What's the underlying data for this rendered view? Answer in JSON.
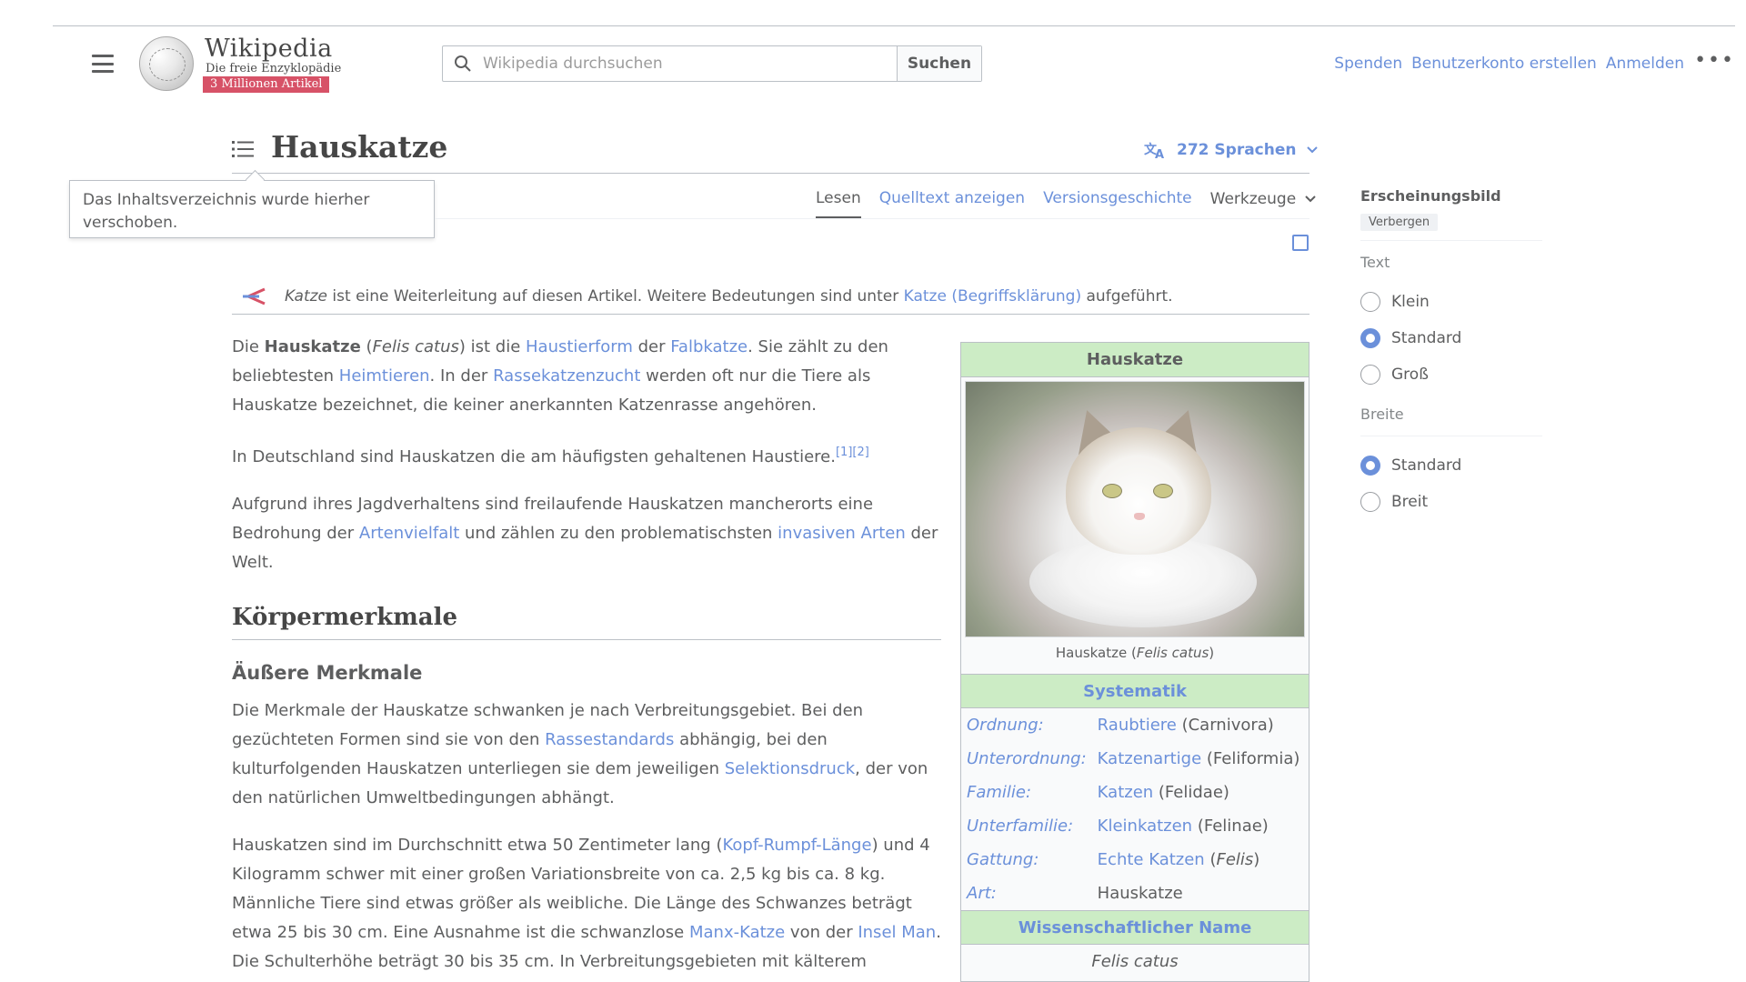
{
  "header": {
    "wordmark": "Wikipedia",
    "tagline": "Die freie Enzyklopädie",
    "badge": "3 Millionen Artikel",
    "search_placeholder": "Wikipedia durchsuchen",
    "search_button": "Suchen",
    "user_links": [
      "Spenden",
      "Benutzerkonto erstellen",
      "Anmelden"
    ],
    "more": "•••"
  },
  "article": {
    "title": "Hauskatze",
    "languages": "272 Sprachen",
    "tooltip": "Das Inhaltsverzeichnis wurde hierher verschoben.",
    "tabs": {
      "read": "Lesen",
      "source": "Quelltext anzeigen",
      "history": "Versionsgeschichte",
      "tools": "Werkzeuge"
    },
    "hatnote": {
      "term": "Katze",
      "text1": " ist eine Weiterleitung auf diesen Artikel. Weitere Bedeutungen sind unter ",
      "link": "Katze (Begriffsklärung)",
      "text2": " aufgeführt."
    },
    "p1": {
      "a": "Die ",
      "b": "Hauskatze",
      "c": " (",
      "d": "Felis catus",
      "e": ") ist die ",
      "f": "Haustierform",
      "g": " der ",
      "h": "Falbkatze",
      "i": ". Sie zählt zu den beliebtesten ",
      "j": "Heimtieren",
      "k": ". In der ",
      "l": "Rassekatzenzucht",
      "m": " werden oft nur die Tiere als Hauskatze bezeichnet, die keiner anerkannten Katzenrasse angehören."
    },
    "p2": {
      "text": "In Deutschland sind Hauskatzen die am häufigsten gehaltenen Haustiere.",
      "refs": "[1][2]"
    },
    "p3": {
      "a": "Aufgrund ihres Jagdverhaltens sind freilaufende Hauskatzen mancherorts eine Bedrohung der ",
      "b": "Artenvielfalt",
      "c": " und zählen zu den problematischsten ",
      "d": "invasiven Arten",
      "e": " der Welt."
    },
    "h2": "Körpermerkmale",
    "h3": "Äußere Merkmale",
    "p4": {
      "a": "Die Merkmale der Hauskatze schwanken je nach Verbreitungsgebiet. Bei den gezüchteten Formen sind sie von den ",
      "b": "Rassestandards",
      "c": " abhängig, bei den kulturfolgenden Hauskatzen unterliegen sie dem jeweiligen ",
      "d": "Selektionsdruck",
      "e": ", der von den natürlichen Umweltbedingungen abhängt."
    },
    "p5": {
      "a": "Hauskatzen sind im Durchschnitt etwa 50 Zentimeter lang (",
      "b": "Kopf-Rumpf-Länge",
      "c": ") und 4 Kilogramm schwer mit einer großen Variationsbreite von ca. 2,5 kg bis ca. 8 kg. Männliche Tiere sind etwas größer als weibliche. Die Länge des Schwanzes beträgt etwa 25 bis 30 cm. Eine Ausnahme ist die schwanzlose ",
      "d": "Manx-Katze",
      "e": " von der ",
      "f": "Insel Man",
      "g": ". Die Schulterhöhe beträgt 30 bis 35 cm. In Verbreitungsgebieten mit kälterem"
    }
  },
  "infobox": {
    "title": "Hauskatze",
    "caption_a": "Hauskatze (",
    "caption_b": "Felis catus",
    "caption_c": ")",
    "systematik": "Systematik",
    "rows": [
      {
        "key": "Ordnung:",
        "link": "Raubtiere",
        "rest": " (Carnivora)"
      },
      {
        "key": "Unterordnung:",
        "link": "Katzenartige",
        "rest": " (Feliformia)"
      },
      {
        "key": "Familie:",
        "link": "Katzen",
        "rest": " (Felidae)"
      },
      {
        "key": "Unterfamilie:",
        "link": "Kleinkatzen",
        "rest": " (Felinae)"
      },
      {
        "key": "Gattung:",
        "link": "Echte Katzen",
        "rest_a": " (",
        "rest_i": "Felis",
        "rest_b": ")"
      },
      {
        "key": "Art:",
        "plain": "Hauskatze"
      }
    ],
    "sci_head": "Wissenschaftlicher Name",
    "sci_name": "Felis catus"
  },
  "appearance": {
    "title": "Erscheinungsbild",
    "hide": "Verbergen",
    "text_label": "Text",
    "text_options": [
      "Klein",
      "Standard",
      "Groß"
    ],
    "width_label": "Breite",
    "width_options": [
      "Standard",
      "Breit"
    ]
  },
  "colors": {
    "link": "#3366cc",
    "infobox_header": "#b9e5b0",
    "badge": "#c8102e"
  }
}
